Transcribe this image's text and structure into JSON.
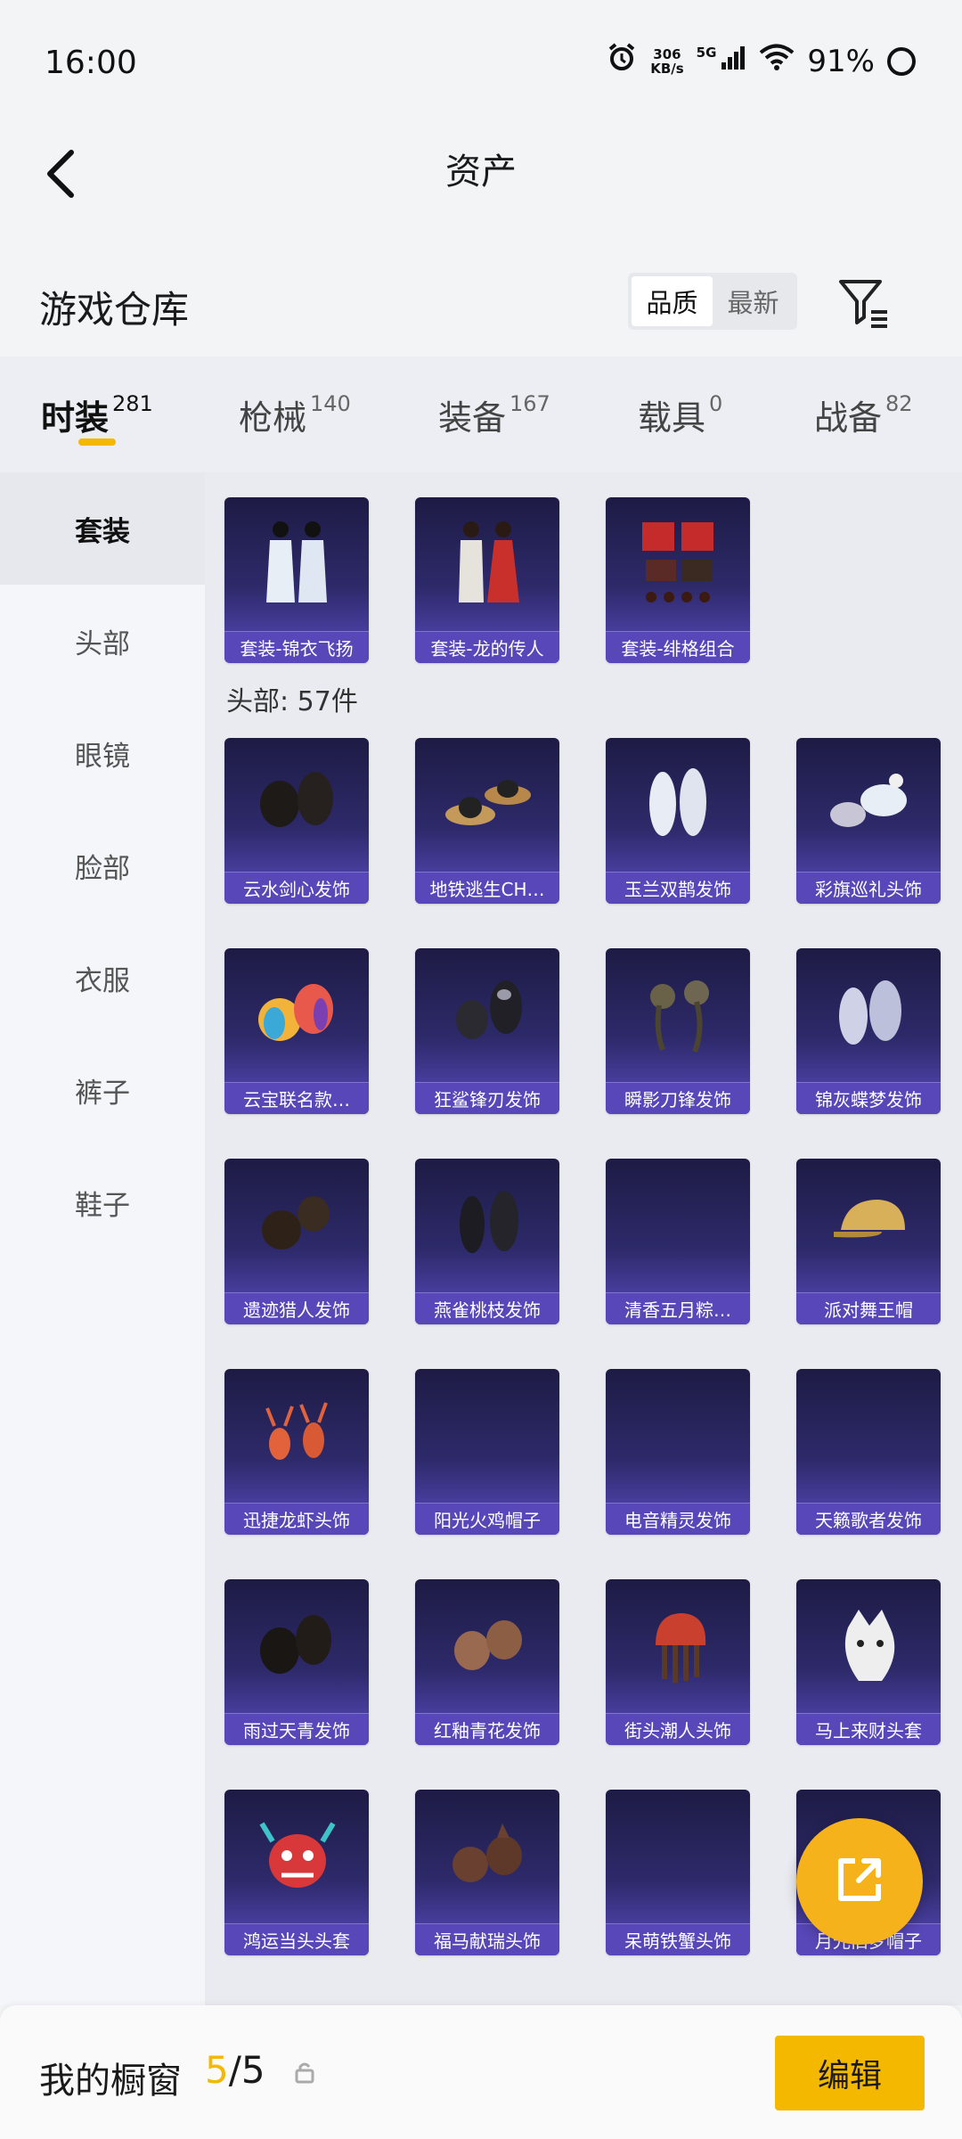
{
  "status_bar": {
    "time": "16:00",
    "speed_top": "306",
    "speed_unit": "KB/s",
    "network": "5G",
    "battery": "91%"
  },
  "header": {
    "title": "资产",
    "back_icon": "chevron-left-icon"
  },
  "warehouse": {
    "title": "游戏仓库",
    "sort_options": [
      "品质",
      "最新"
    ],
    "sort_active": "品质",
    "filter_icon": "filter-icon"
  },
  "category_tabs": [
    {
      "label": "时装",
      "count": "281",
      "active": true
    },
    {
      "label": "枪械",
      "count": "140"
    },
    {
      "label": "装备",
      "count": "167"
    },
    {
      "label": "载具",
      "count": "0"
    },
    {
      "label": "战备",
      "count": "82"
    }
  ],
  "side_nav": {
    "items": [
      "套装",
      "头部",
      "眼镜",
      "脸部",
      "衣服",
      "裤子",
      "鞋子"
    ],
    "active": "套装"
  },
  "suits": [
    "套装-锦衣飞扬",
    "套装-龙的传人",
    "套装-绯格组合"
  ],
  "head_section": {
    "label": "头部: 57件",
    "items": [
      "云水剑心发饰",
      "地铁逃生CH…",
      "玉兰双鹊发饰",
      "彩旗巡礼头饰",
      "云宝联名款…",
      "狂鲨锋刃发饰",
      "瞬影刀锋发饰",
      "锦灰蝶梦发饰",
      "遗迹猎人发饰",
      "燕雀桃枝发饰",
      "清香五月粽…",
      "派对舞王帽",
      "迅捷龙虾头饰",
      "阳光火鸡帽子",
      "电音精灵发饰",
      "天籁歌者发饰",
      "雨过天青发饰",
      "红釉青花发饰",
      "街头潮人头饰",
      "马上来财头套",
      "鸿运当头头套",
      "福马献瑞头饰",
      "呆萌铁蟹头饰",
      "月光旧梦帽子"
    ]
  },
  "fab_icon": "share-icon",
  "bottom_bar": {
    "label": "我的橱窗",
    "current": "5",
    "separator": "/",
    "total": "5",
    "lock_icon": "lock-icon",
    "edit_label": "编辑"
  },
  "colors": {
    "accent": "#f5b800",
    "card_label": "#5747b8"
  }
}
